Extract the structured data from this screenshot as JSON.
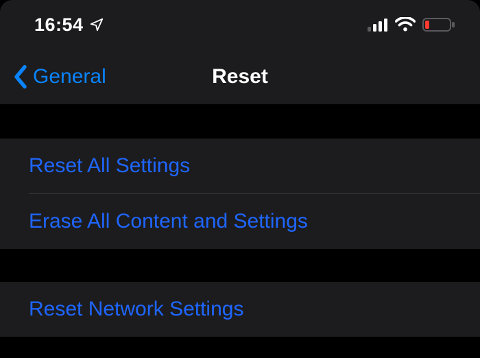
{
  "status": {
    "time": "16:54"
  },
  "nav": {
    "back_label": "General",
    "title": "Reset"
  },
  "groups": [
    {
      "items": [
        {
          "label": "Reset All Settings"
        },
        {
          "label": "Erase All Content and Settings"
        }
      ]
    },
    {
      "items": [
        {
          "label": "Reset Network Settings"
        }
      ]
    }
  ],
  "colors": {
    "accent": "#0a84ff",
    "link": "#1f66ff",
    "panel": "#1c1c1e",
    "battery_low": "#ff3b30"
  }
}
